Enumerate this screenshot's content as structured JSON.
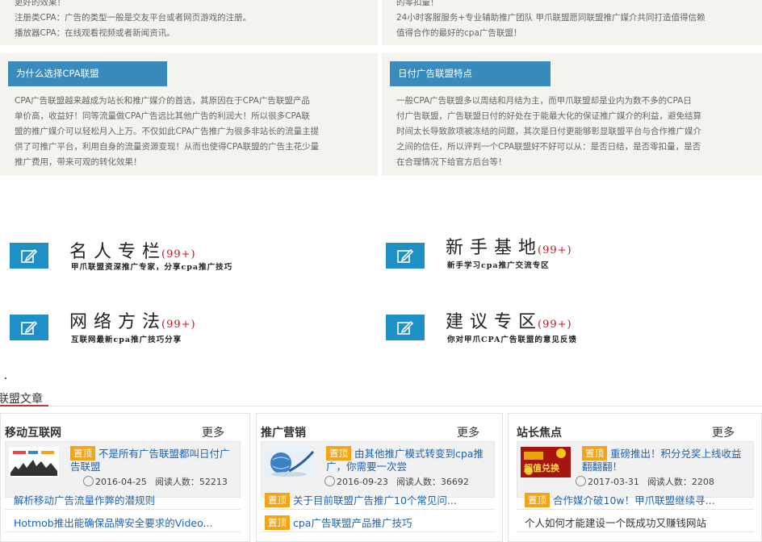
{
  "top_left": {
    "lines": [
      "更好的效果！",
      "注册类CPA：广告的类型一般是交友平台或者网页游戏的注册。",
      "播放器CPA：在线观看视频或者新闻资讯。"
    ]
  },
  "top_right": {
    "lines": [
      "的零扣量！",
      "24小时客服服务+专业辅助推广团队 甲爪联盟愿同联盟推广媒介共同打造值得信赖",
      "值得合作的最好的cpa广告联盟！"
    ]
  },
  "why_cpa": {
    "heading": "为什么选择CPA联盟",
    "lines": [
      "CPA广告联盟越来越成为站长和推广媒介的首选，其原因在于CPA广告联盟产品",
      "单价高，收益好！同等流量做CPA广告远比其他广告的利润大！所以很多CPA联",
      "盟的推广媒介可以轻松月入上万。不仅如此CPA广告推广为很多非站长的流量主提",
      "供了可推广平台，利用自身的流量资源变现！从而也使得CPA联盟的广告主花少量",
      "推广费用，带来可观的转化效果！"
    ]
  },
  "daily_pay": {
    "heading": "日付广告联盟特点",
    "lines": [
      "一般CPA广告联盟多以周结和月结为主，而甲爪联盟却是业内为数不多的CPA日",
      "付广告联盟，广告联盟日付的好处在于能最大化的保证推广媒介的利益，避免结算",
      "时间太长导致款项被冻结的问题，其次是日付更能够彰显联盟平台与合作推广媒介",
      "之间的信任，所以评判一个CPA联盟好不好可以从：是否日结，是否零扣量，是否",
      "在合理情况下给官方后台等！"
    ]
  },
  "forums": [
    {
      "title": "名人专栏",
      "count": "(99+)",
      "desc": "甲爪联盟资深推广专家，分享cpa推广技巧"
    },
    {
      "title": "新手基地",
      "count": "(99+)",
      "desc": "新手学习cpa推广交流专区"
    },
    {
      "title": "网络方法",
      "count": "(99+)",
      "desc": "互联网最新cpa推广技巧分享"
    },
    {
      "title": "建议专区",
      "count": "(99+)",
      "desc": "你对甲爪CPA广告联盟的意见反馈"
    }
  ],
  "articles_section": {
    "title": "联盟文章"
  },
  "columns": [
    {
      "title": "移动互联网",
      "more": "更多",
      "featured": {
        "badge": "置顶",
        "title": "不是所有广告联盟都叫日付广告联盟",
        "date": "2016-04-25",
        "views": "阅读人数：52213"
      },
      "list": [
        {
          "badge": "",
          "text": "解析移动广告流量作弊的潜规则"
        },
        {
          "badge": "",
          "text": "Hotmob推出能确保品牌安全要求的Video..."
        }
      ]
    },
    {
      "title": "推广营销",
      "more": "更多",
      "featured": {
        "badge": "置顶",
        "title": "由其他推广模式转变到cpa推广，你需要一次尝",
        "date": "2016-09-23",
        "views": "阅读人数：36692"
      },
      "list": [
        {
          "badge": "置顶",
          "text": "关于目前联盟广告推广10个常见问..."
        },
        {
          "badge": "置顶",
          "text": "cpa广告联盟产品推广技巧"
        }
      ]
    },
    {
      "title": "站长焦点",
      "more": "更多",
      "featured": {
        "badge": "置顶",
        "title": "重磅推出！积分兑奖上线收益翻翻翻！",
        "date": "2017-03-31",
        "views": "阅读人数：2208",
        "thumb_text": "超值兑换"
      },
      "list": [
        {
          "badge": "置顶",
          "text": "合作媒介破10w！甲爪联盟继续寻..."
        },
        {
          "badge": "",
          "text": "个人如何才能建设一个既成功又赚钱网站"
        }
      ]
    }
  ],
  "colors": {
    "accent_blue": "#3a8bbd",
    "icon_blue": "#1f8fc8",
    "badge_orange": "#f5a417",
    "count_red": "#d0111b",
    "link_blue": "#1a63b5",
    "panel_bg": "#f4f3ee",
    "section_underline": "#c0392b"
  }
}
